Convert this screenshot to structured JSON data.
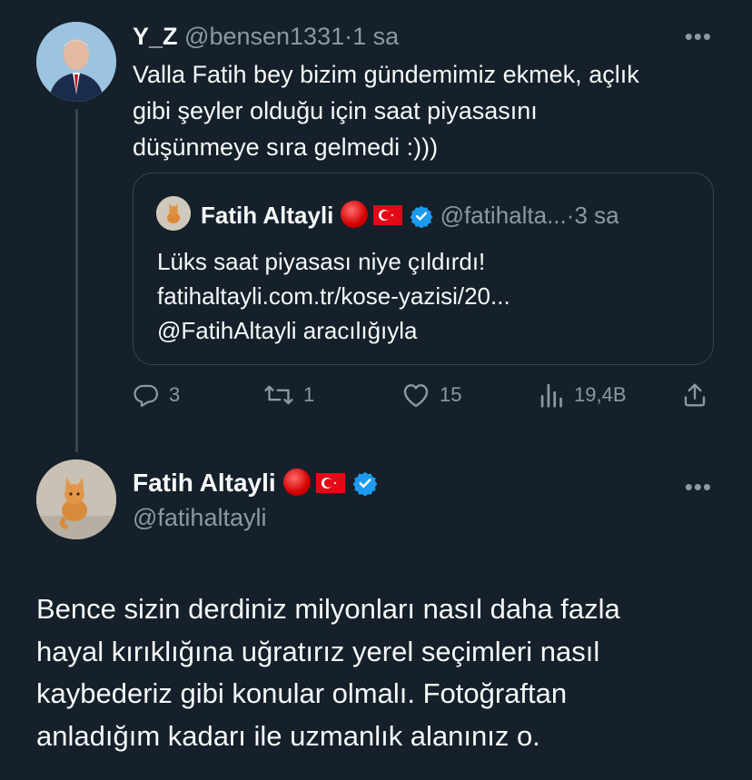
{
  "reply_tweet": {
    "name": "Y_Z",
    "handle": "@bensen1331",
    "separator": "·",
    "time": "1 sa",
    "text_lines": [
      "Valla Fatih bey bizim gündemimiz ekmek, açlık",
      "gibi şeyler olduğu için saat piyasasını",
      "düşünmeye sıra gelmedi :)))"
    ],
    "quoted": {
      "name": "Fatih Altayli",
      "handle": "@fatihalta...",
      "separator": "·",
      "time": "3 sa",
      "text_lines": [
        "Lüks saat piyasası niye çıldırdı!",
        "fatihaltayli.com.tr/kose-yazisi/20...",
        "@FatihAltayli aracılığıyla"
      ]
    },
    "actions": {
      "replies": "3",
      "retweets": "1",
      "likes": "15",
      "views": "19,4B"
    }
  },
  "main_tweet": {
    "name": "Fatih Altayli",
    "handle": "@fatihaltayli",
    "text_lines": [
      "Bence sizin derdiniz milyonları nasıl daha fazla",
      "hayal kırıklığına uğratırız yerel seçimleri nasıl",
      "kaybederiz gibi konular olmalı. Fotoğraftan",
      "anladığım kadarı ile uzmanlık alanınız o."
    ]
  },
  "colors": {
    "background": "#15202b",
    "text": "#f7f9f9",
    "muted": "#8b98a5",
    "border": "#38444d",
    "verified": "#1d9bf0"
  }
}
